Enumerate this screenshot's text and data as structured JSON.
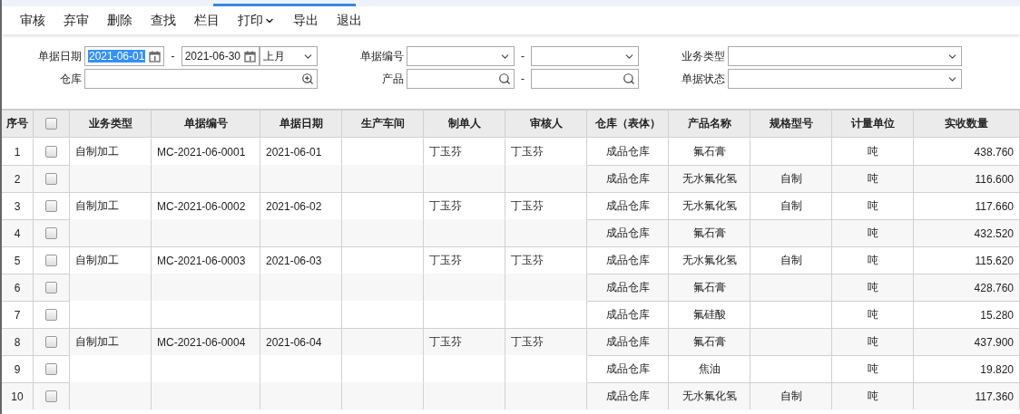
{
  "toolbar": [
    {
      "label": "审核",
      "has_menu": false
    },
    {
      "label": "弃审",
      "has_menu": false
    },
    {
      "label": "删除",
      "has_menu": false
    },
    {
      "label": "查找",
      "has_menu": false
    },
    {
      "label": "栏目",
      "has_menu": false
    },
    {
      "label": "打印",
      "has_menu": true
    },
    {
      "label": "导出",
      "has_menu": false
    },
    {
      "label": "退出",
      "has_menu": false
    }
  ],
  "filters": {
    "date": {
      "label": "单据日期",
      "from": "2021-06-01",
      "from_highlighted": true,
      "to": "2021-06-30",
      "separator": "-",
      "period": "上月"
    },
    "number": {
      "label": "单据编号",
      "separator": "-"
    },
    "business_type": {
      "label": "业务类型"
    },
    "warehouse": {
      "label": "仓库"
    },
    "product": {
      "label": "产品",
      "separator": "-"
    },
    "status": {
      "label": "单据状态"
    }
  },
  "table": {
    "columns": [
      "序号",
      "",
      "业务类型",
      "单据编号",
      "单据日期",
      "生产车间",
      "制单人",
      "审核人",
      "仓库（表体）",
      "产品名称",
      "规格型号",
      "计量单位",
      "实收数量"
    ],
    "header_checked": false,
    "groups": [
      {
        "type": "自制加工",
        "number": "MC-2021-06-0001",
        "date": "2021-06-01",
        "maker": "丁玉芬",
        "reviewer": "丁玉芬",
        "lines": [
          {
            "no": "1",
            "checked": false,
            "warehouse": "成品仓库",
            "product": "氟石膏",
            "unit": "吨",
            "qty": "438.760"
          },
          {
            "no": "2",
            "checked": false,
            "warehouse": "成品仓库",
            "product": "无水氟化氢",
            "spec": "自制",
            "unit": "吨",
            "qty": "116.600"
          }
        ]
      },
      {
        "type": "自制加工",
        "number": "MC-2021-06-0002",
        "date": "2021-06-02",
        "maker": "丁玉芬",
        "reviewer": "丁玉芬",
        "lines": [
          {
            "no": "3",
            "checked": false,
            "warehouse": "成品仓库",
            "product": "无水氟化氢",
            "spec": "自制",
            "unit": "吨",
            "qty": "117.660"
          },
          {
            "no": "4",
            "checked": false,
            "warehouse": "成品仓库",
            "product": "氟石膏",
            "unit": "吨",
            "qty": "432.520"
          }
        ]
      },
      {
        "type": "自制加工",
        "number": "MC-2021-06-0003",
        "date": "2021-06-03",
        "maker": "丁玉芬",
        "reviewer": "丁玉芬",
        "lines": [
          {
            "no": "5",
            "checked": false,
            "warehouse": "成品仓库",
            "product": "无水氟化氢",
            "spec": "自制",
            "unit": "吨",
            "qty": "115.620"
          },
          {
            "no": "6",
            "checked": false,
            "warehouse": "成品仓库",
            "product": "氟石膏",
            "unit": "吨",
            "qty": "428.760"
          },
          {
            "no": "7",
            "checked": false,
            "warehouse": "成品仓库",
            "product": "氟硅酸",
            "unit": "吨",
            "qty": "15.280"
          }
        ]
      },
      {
        "type": "自制加工",
        "number": "MC-2021-06-0004",
        "date": "2021-06-04",
        "maker": "丁玉芬",
        "reviewer": "丁玉芬",
        "lines": [
          {
            "no": "8",
            "checked": false,
            "warehouse": "成品仓库",
            "product": "氟石膏",
            "unit": "吨",
            "qty": "437.900"
          },
          {
            "no": "9",
            "checked": false,
            "warehouse": "成品仓库",
            "product": "焦油",
            "unit": "吨",
            "qty": "19.820"
          },
          {
            "no": "10",
            "checked": false,
            "warehouse": "成品仓库",
            "product": "无水氟化氢",
            "spec": "自制",
            "unit": "吨",
            "qty": "117.360"
          }
        ]
      }
    ]
  }
}
